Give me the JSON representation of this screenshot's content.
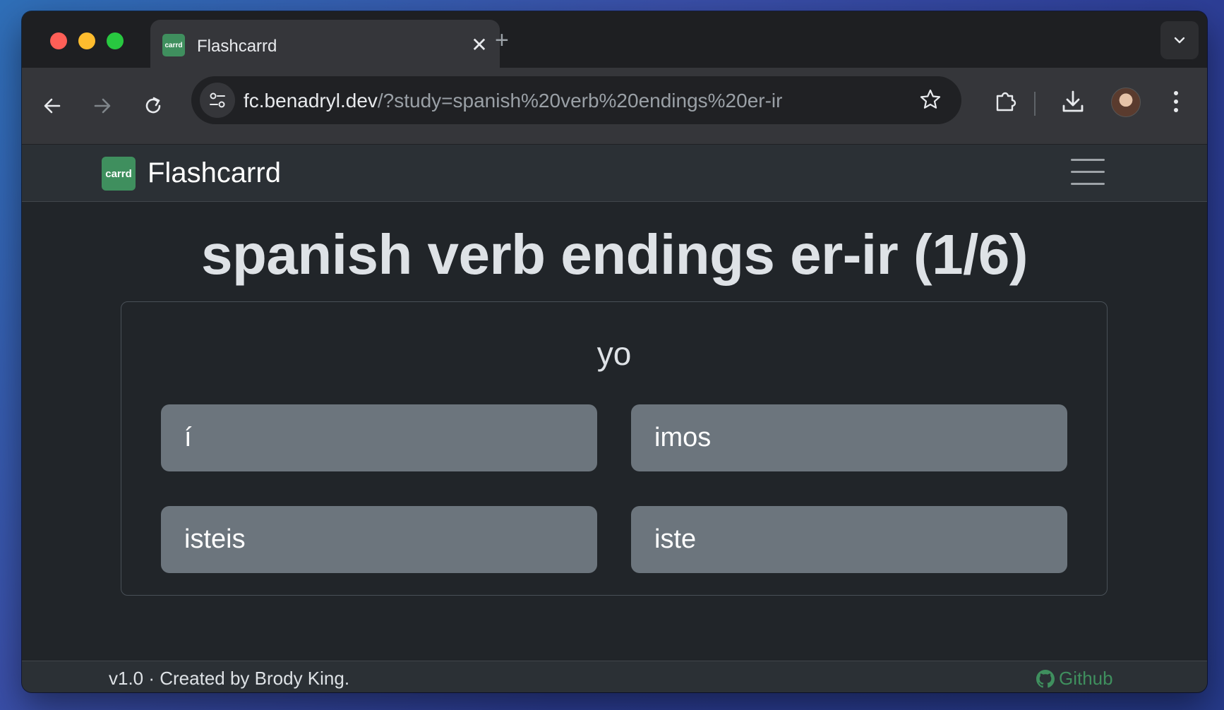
{
  "browser": {
    "tab_title": "Flashcarrd",
    "tab_favicon_text": "carrd",
    "close_tab": "✕",
    "new_tab": "+",
    "url_host": "fc.benadryl.dev",
    "url_path": "/?study=spanish%20verb%20endings%20er-ir"
  },
  "navbar": {
    "logo_text": "carrd",
    "brand": "Flashcarrd"
  },
  "study": {
    "title": "spanish verb endings er-ir (1/6)",
    "prompt": "yo",
    "choices": [
      "í",
      "imos",
      "isteis",
      "iste"
    ]
  },
  "footer": {
    "text": "v1.0 · Created by Brody King.",
    "github": "Github"
  },
  "colors": {
    "brand_green": "#3f8f5e",
    "choice_bg": "#6c757d",
    "page_bg": "#212529"
  }
}
